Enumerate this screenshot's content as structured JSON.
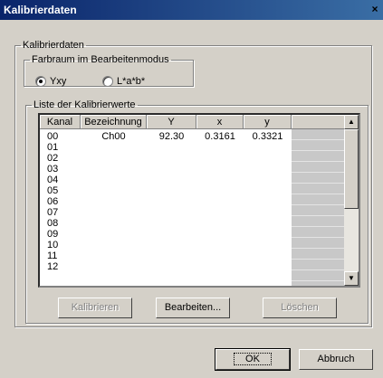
{
  "window": {
    "title": "Kalibrierdaten",
    "close_label": "×"
  },
  "group_main": {
    "legend": "Kalibrierdaten"
  },
  "farbraum": {
    "legend": "Farbraum im Bearbeitenmodus",
    "options": [
      {
        "label": "Yxy",
        "selected": true
      },
      {
        "label": "L*a*b*",
        "selected": false
      }
    ]
  },
  "liste": {
    "legend": "Liste der Kalibrierwerte",
    "columns": [
      "Kanal",
      "Bezeichnung",
      "Y",
      "x",
      "y"
    ],
    "rows": [
      {
        "kanal": "00",
        "bezeichnung": "Ch00",
        "Y": "92.30",
        "x": "0.3161",
        "y": "0.3321"
      },
      {
        "kanal": "01"
      },
      {
        "kanal": "02"
      },
      {
        "kanal": "03"
      },
      {
        "kanal": "04"
      },
      {
        "kanal": "05"
      },
      {
        "kanal": "06"
      },
      {
        "kanal": "07"
      },
      {
        "kanal": "08"
      },
      {
        "kanal": "09"
      },
      {
        "kanal": "10"
      },
      {
        "kanal": "11"
      },
      {
        "kanal": "12"
      }
    ]
  },
  "buttons": {
    "kalibrieren": "Kalibrieren",
    "bearbeiten": "Bearbeiten...",
    "loeschen": "Löschen",
    "ok": "OK",
    "abbruch": "Abbruch"
  },
  "colors": {
    "titlebar_start": "#0a246a",
    "titlebar_end": "#3a6ea5",
    "face": "#d4d0c8"
  }
}
